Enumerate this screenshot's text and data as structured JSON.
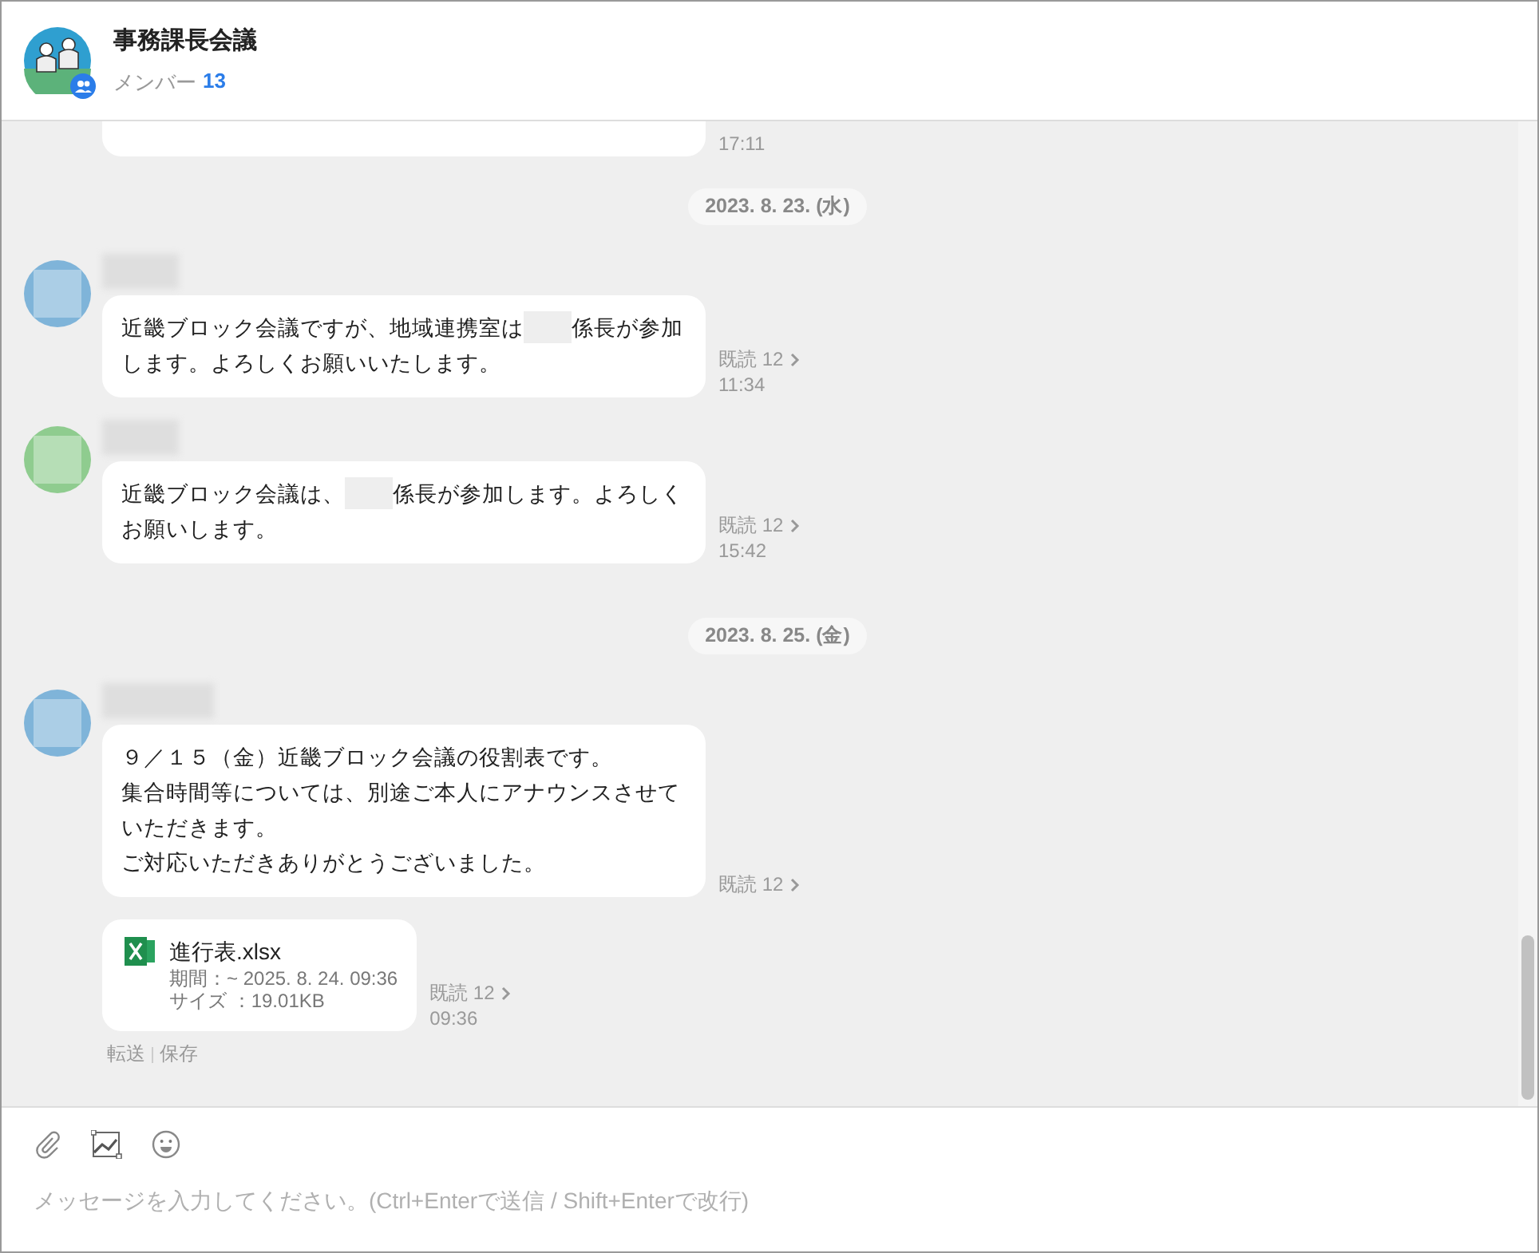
{
  "header": {
    "title": "事務課長会議",
    "members_label": "メンバー",
    "members_count": "13"
  },
  "messages": [
    {
      "kind": "partial",
      "time": "17:11"
    },
    {
      "kind": "date",
      "label": "2023. 8. 23. (水)"
    },
    {
      "kind": "text",
      "color": "#7fb4d9",
      "parts": [
        {
          "kind": "text",
          "text": "近畿ブロック会議ですが、地域連携室は"
        },
        {
          "kind": "redacted"
        },
        {
          "kind": "text",
          "text": "係長が参加します。よろしくお願いいたします。"
        }
      ],
      "read": "既読 12",
      "time": "11:34"
    },
    {
      "kind": "text",
      "color": "#8fcc8f",
      "parts": [
        {
          "kind": "text",
          "text": "近畿ブロック会議は、"
        },
        {
          "kind": "redacted"
        },
        {
          "kind": "text",
          "text": "係長が参加します。よろしくお願いします。"
        }
      ],
      "read": "既読 12",
      "time": "15:42"
    },
    {
      "kind": "date",
      "label": "2023. 8. 25. (金)"
    },
    {
      "kind": "text",
      "color": "#7fb4d9",
      "parts": [
        {
          "kind": "text",
          "text": "９／１５（金）近畿ブロック会議の役割表です。"
        },
        {
          "kind": "break"
        },
        {
          "kind": "text",
          "text": "集合時間等については、別途ご本人にアナウンスさせていただきます。"
        },
        {
          "kind": "break"
        },
        {
          "kind": "text",
          "text": "ご対応いただきありがとうございました。"
        }
      ],
      "read": "既読 12"
    },
    {
      "kind": "file",
      "name": "進行表.xlsx",
      "period": "期間：~ 2025. 8. 24. 09:36",
      "size": "サイズ ：19.01KB",
      "read": "既読 12",
      "time": "09:36",
      "actions": [
        "転送",
        "保存"
      ]
    }
  ],
  "composer": {
    "placeholder": "メッセージを入力してください。(Ctrl+Enterで送信 / Shift+Enterで改行)"
  }
}
